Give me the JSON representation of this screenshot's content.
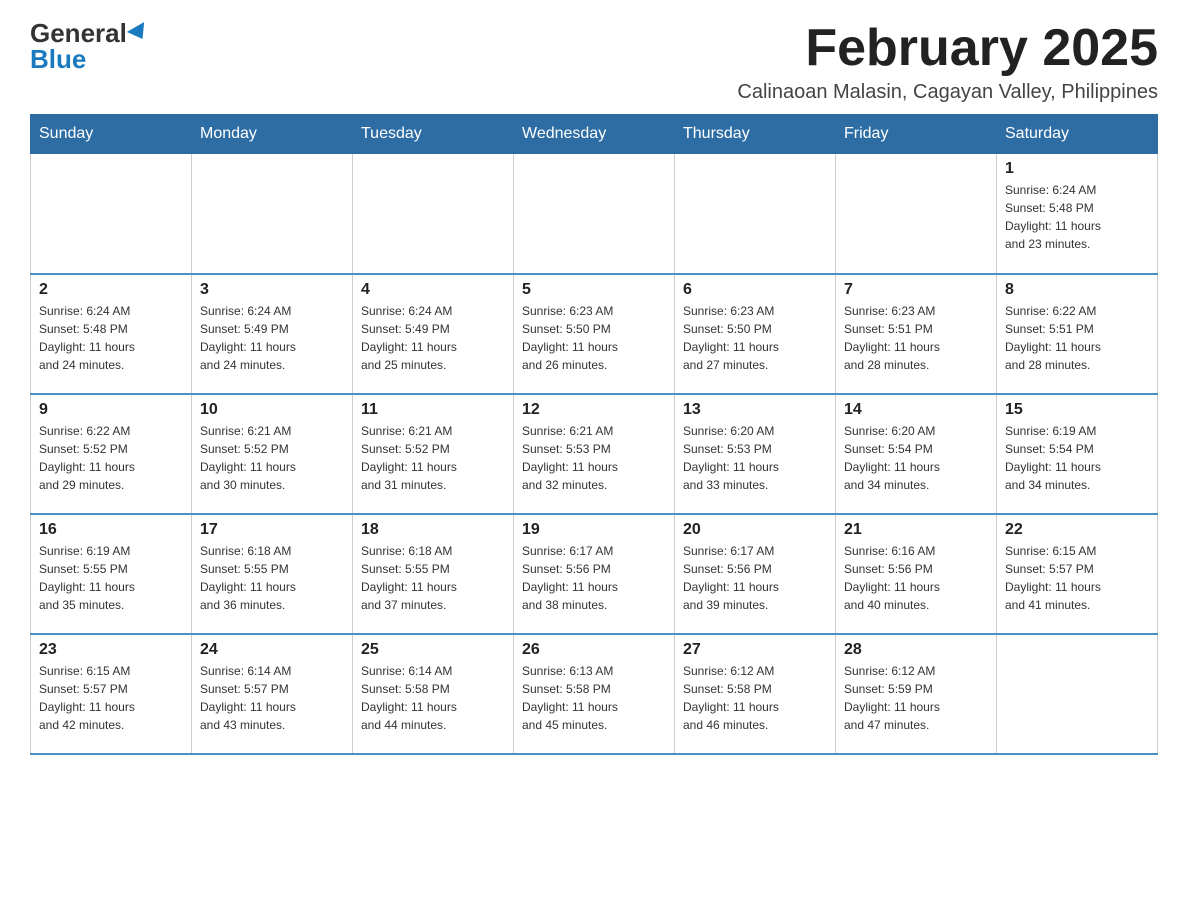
{
  "logo": {
    "general": "General",
    "blue": "Blue"
  },
  "title": "February 2025",
  "subtitle": "Calinaoan Malasin, Cagayan Valley, Philippines",
  "weekdays": [
    "Sunday",
    "Monday",
    "Tuesday",
    "Wednesday",
    "Thursday",
    "Friday",
    "Saturday"
  ],
  "weeks": [
    [
      {
        "day": "",
        "info": ""
      },
      {
        "day": "",
        "info": ""
      },
      {
        "day": "",
        "info": ""
      },
      {
        "day": "",
        "info": ""
      },
      {
        "day": "",
        "info": ""
      },
      {
        "day": "",
        "info": ""
      },
      {
        "day": "1",
        "info": "Sunrise: 6:24 AM\nSunset: 5:48 PM\nDaylight: 11 hours\nand 23 minutes."
      }
    ],
    [
      {
        "day": "2",
        "info": "Sunrise: 6:24 AM\nSunset: 5:48 PM\nDaylight: 11 hours\nand 24 minutes."
      },
      {
        "day": "3",
        "info": "Sunrise: 6:24 AM\nSunset: 5:49 PM\nDaylight: 11 hours\nand 24 minutes."
      },
      {
        "day": "4",
        "info": "Sunrise: 6:24 AM\nSunset: 5:49 PM\nDaylight: 11 hours\nand 25 minutes."
      },
      {
        "day": "5",
        "info": "Sunrise: 6:23 AM\nSunset: 5:50 PM\nDaylight: 11 hours\nand 26 minutes."
      },
      {
        "day": "6",
        "info": "Sunrise: 6:23 AM\nSunset: 5:50 PM\nDaylight: 11 hours\nand 27 minutes."
      },
      {
        "day": "7",
        "info": "Sunrise: 6:23 AM\nSunset: 5:51 PM\nDaylight: 11 hours\nand 28 minutes."
      },
      {
        "day": "8",
        "info": "Sunrise: 6:22 AM\nSunset: 5:51 PM\nDaylight: 11 hours\nand 28 minutes."
      }
    ],
    [
      {
        "day": "9",
        "info": "Sunrise: 6:22 AM\nSunset: 5:52 PM\nDaylight: 11 hours\nand 29 minutes."
      },
      {
        "day": "10",
        "info": "Sunrise: 6:21 AM\nSunset: 5:52 PM\nDaylight: 11 hours\nand 30 minutes."
      },
      {
        "day": "11",
        "info": "Sunrise: 6:21 AM\nSunset: 5:52 PM\nDaylight: 11 hours\nand 31 minutes."
      },
      {
        "day": "12",
        "info": "Sunrise: 6:21 AM\nSunset: 5:53 PM\nDaylight: 11 hours\nand 32 minutes."
      },
      {
        "day": "13",
        "info": "Sunrise: 6:20 AM\nSunset: 5:53 PM\nDaylight: 11 hours\nand 33 minutes."
      },
      {
        "day": "14",
        "info": "Sunrise: 6:20 AM\nSunset: 5:54 PM\nDaylight: 11 hours\nand 34 minutes."
      },
      {
        "day": "15",
        "info": "Sunrise: 6:19 AM\nSunset: 5:54 PM\nDaylight: 11 hours\nand 34 minutes."
      }
    ],
    [
      {
        "day": "16",
        "info": "Sunrise: 6:19 AM\nSunset: 5:55 PM\nDaylight: 11 hours\nand 35 minutes."
      },
      {
        "day": "17",
        "info": "Sunrise: 6:18 AM\nSunset: 5:55 PM\nDaylight: 11 hours\nand 36 minutes."
      },
      {
        "day": "18",
        "info": "Sunrise: 6:18 AM\nSunset: 5:55 PM\nDaylight: 11 hours\nand 37 minutes."
      },
      {
        "day": "19",
        "info": "Sunrise: 6:17 AM\nSunset: 5:56 PM\nDaylight: 11 hours\nand 38 minutes."
      },
      {
        "day": "20",
        "info": "Sunrise: 6:17 AM\nSunset: 5:56 PM\nDaylight: 11 hours\nand 39 minutes."
      },
      {
        "day": "21",
        "info": "Sunrise: 6:16 AM\nSunset: 5:56 PM\nDaylight: 11 hours\nand 40 minutes."
      },
      {
        "day": "22",
        "info": "Sunrise: 6:15 AM\nSunset: 5:57 PM\nDaylight: 11 hours\nand 41 minutes."
      }
    ],
    [
      {
        "day": "23",
        "info": "Sunrise: 6:15 AM\nSunset: 5:57 PM\nDaylight: 11 hours\nand 42 minutes."
      },
      {
        "day": "24",
        "info": "Sunrise: 6:14 AM\nSunset: 5:57 PM\nDaylight: 11 hours\nand 43 minutes."
      },
      {
        "day": "25",
        "info": "Sunrise: 6:14 AM\nSunset: 5:58 PM\nDaylight: 11 hours\nand 44 minutes."
      },
      {
        "day": "26",
        "info": "Sunrise: 6:13 AM\nSunset: 5:58 PM\nDaylight: 11 hours\nand 45 minutes."
      },
      {
        "day": "27",
        "info": "Sunrise: 6:12 AM\nSunset: 5:58 PM\nDaylight: 11 hours\nand 46 minutes."
      },
      {
        "day": "28",
        "info": "Sunrise: 6:12 AM\nSunset: 5:59 PM\nDaylight: 11 hours\nand 47 minutes."
      },
      {
        "day": "",
        "info": ""
      }
    ]
  ]
}
